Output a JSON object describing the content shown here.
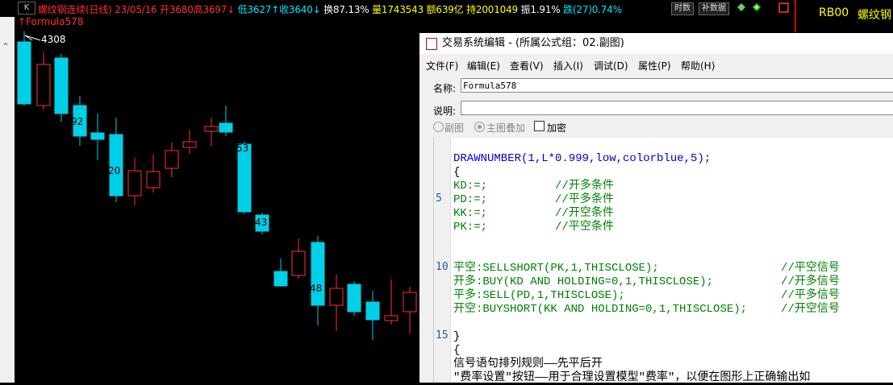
{
  "topbar": {
    "k_button": "K",
    "name_date": "螺纹钢连续(日线) 23/05/16",
    "open": "开3680",
    "high": "高3697↓",
    "low": "低3627↑",
    "close": "收3640↓",
    "turnover_rate": "换87.13%",
    "volume": "量1743543",
    "amount": "额639亿",
    "open_interest": "持2001049",
    "amplitude": "振1.91%",
    "change": "跌(27)0.74%",
    "btn_period": "时数",
    "btn_supplement": "补数据"
  },
  "right_panel": {
    "code": "RB00",
    "name": "螺纹钢"
  },
  "chart": {
    "formula_label": "Formula578",
    "max_label": "4308",
    "number_labels": [
      "92",
      "20",
      "53",
      "43",
      "48"
    ]
  },
  "editor": {
    "title": "交易系统编辑 - (所属公式组：02.副图)",
    "menu": [
      "文件(F)",
      "编辑(E)",
      "查看(V)",
      "插入(I)",
      "调试(D)",
      "属性(P)",
      "帮助(H)"
    ],
    "name_label": "名称:",
    "name_value": "Formula578",
    "desc_label": "说明:",
    "desc_value": "",
    "option_sub": "副图",
    "option_main": "主图叠加",
    "option_encrypt": "加密",
    "line_numbers": [
      "5",
      "10",
      "15"
    ],
    "code_lines": [
      "DRAWNUMBER(1,L*0.999,low,colorblue,5);",
      "{",
      "KD:=;          //开多条件",
      "PD:=;          //平多条件",
      "KK:=;          //开空条件",
      "PK:=;          //平空条件",
      "平空:SELLSHORT(PK,1,THISCLOSE);                  //平空信号",
      "开多:BUY(KD AND HOLDING=0,1,THISCLOSE);          //开多信号",
      "平多:SELL(PD,1,THISCLOSE);                       //平多信号",
      "开空:BUYSHORT(KK AND HOLDING=0,1,THISCLOSE);     //开空信号",
      "}",
      "{",
      "信号语句排列规则——先平后开",
      "\"费率设置\"按钮——用于合理设置模型\"费率\"，以便在图形上正确输出如"
    ]
  },
  "colors": {
    "up": "#ff3030",
    "down": "#00cfe8",
    "text_cyan": "#00e5ff"
  }
}
